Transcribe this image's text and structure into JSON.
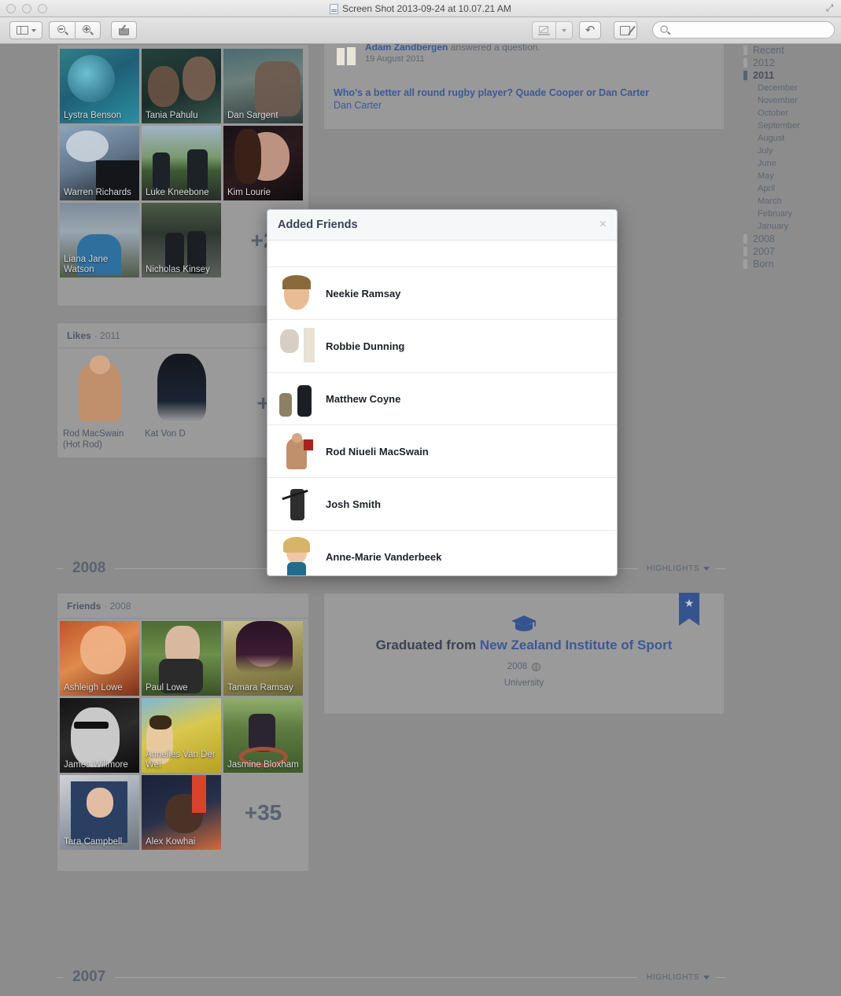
{
  "window": {
    "title": "Screen Shot 2013-09-24 at 10.07.21 AM",
    "traffic_lights": [
      "close",
      "minimize",
      "zoom"
    ],
    "toolbar": {
      "sidebar_label": "Sidebar",
      "zoom_out_label": "Zoom Out",
      "zoom_in_label": "Zoom In",
      "share_label": "Share",
      "annotate_label": "Annotate",
      "rotate_label": "Rotate",
      "markup_label": "Markup",
      "search_placeholder": ""
    }
  },
  "modal": {
    "title": "Added Friends",
    "close_label": "×",
    "friends": [
      {
        "name": ""
      },
      {
        "name": "Neekie Ramsay"
      },
      {
        "name": "Robbie Dunning"
      },
      {
        "name": "Matthew Coyne"
      },
      {
        "name": "Rod Niueli MacSwain"
      },
      {
        "name": "Josh Smith"
      },
      {
        "name": "Anne-Marie Vanderbeek"
      }
    ]
  },
  "story": {
    "actor": "Adam Zandbergen",
    "action": " answered a question.",
    "time": "19 August 2011",
    "question": "Who's a better all round rugby player? Quade Cooper or Dan Carter",
    "answer": "Dan Carter"
  },
  "friends_2011": {
    "tiles": [
      {
        "name": "Lystra Benson"
      },
      {
        "name": "Tania Pahulu"
      },
      {
        "name": "Dan Sargent"
      },
      {
        "name": "Warren Richards"
      },
      {
        "name": "Luke Kneebone"
      },
      {
        "name": "Kim Lourie"
      },
      {
        "name": "Liana Jane Watson"
      },
      {
        "name": "Nicholas Kinsey"
      }
    ],
    "more_label": "+2"
  },
  "likes_2011": {
    "header": "Likes",
    "year": "· 2011",
    "items": [
      {
        "name": "Rod MacSwain (Hot Rod)"
      },
      {
        "name": "Kat Von D"
      }
    ],
    "more_label": "+"
  },
  "year_2008": {
    "label": "2008",
    "highlights_label": "HIGHLIGHTS"
  },
  "year_2007": {
    "label": "2007",
    "highlights_label": "HIGHLIGHTS"
  },
  "friends_2008": {
    "header": "Friends",
    "year": "· 2008",
    "tiles": [
      {
        "name": "Ashleigh Lowe"
      },
      {
        "name": "Paul Lowe"
      },
      {
        "name": "Tamara Ramsay"
      },
      {
        "name": "James Willmore"
      },
      {
        "name": "Annelies Van Der Wel"
      },
      {
        "name": "Jasmine Bloxham"
      },
      {
        "name": "Tara Campbell"
      },
      {
        "name": "Alex Kowhai"
      }
    ],
    "more_label": "+35"
  },
  "life_event": {
    "prefix": "Graduated from ",
    "school": "New Zealand Institute of Sport",
    "date": "2008",
    "type": "University",
    "star": "★"
  },
  "year_nav": {
    "items": [
      {
        "label": "Recent",
        "type": "year",
        "active": false
      },
      {
        "label": "2012",
        "type": "year",
        "active": false
      },
      {
        "label": "2011",
        "type": "year",
        "active": true
      },
      {
        "label": "December",
        "type": "month",
        "active": false
      },
      {
        "label": "November",
        "type": "month",
        "active": false
      },
      {
        "label": "October",
        "type": "month",
        "active": false
      },
      {
        "label": "September",
        "type": "month",
        "active": false
      },
      {
        "label": "August",
        "type": "month",
        "active": false
      },
      {
        "label": "July",
        "type": "month",
        "active": false
      },
      {
        "label": "June",
        "type": "month",
        "active": false
      },
      {
        "label": "May",
        "type": "month",
        "active": false
      },
      {
        "label": "April",
        "type": "month",
        "active": false
      },
      {
        "label": "March",
        "type": "month",
        "active": false
      },
      {
        "label": "February",
        "type": "month",
        "active": false
      },
      {
        "label": "January",
        "type": "month",
        "active": false
      },
      {
        "label": "2008",
        "type": "year",
        "active": false
      },
      {
        "label": "2007",
        "type": "year",
        "active": false
      },
      {
        "label": "Born",
        "type": "year",
        "active": false
      }
    ]
  },
  "colors": {
    "fb_blue": "#3b5998",
    "page_bg": "#8c8c8c",
    "modal_bg": "#ffffff",
    "flag": "#35538f"
  }
}
